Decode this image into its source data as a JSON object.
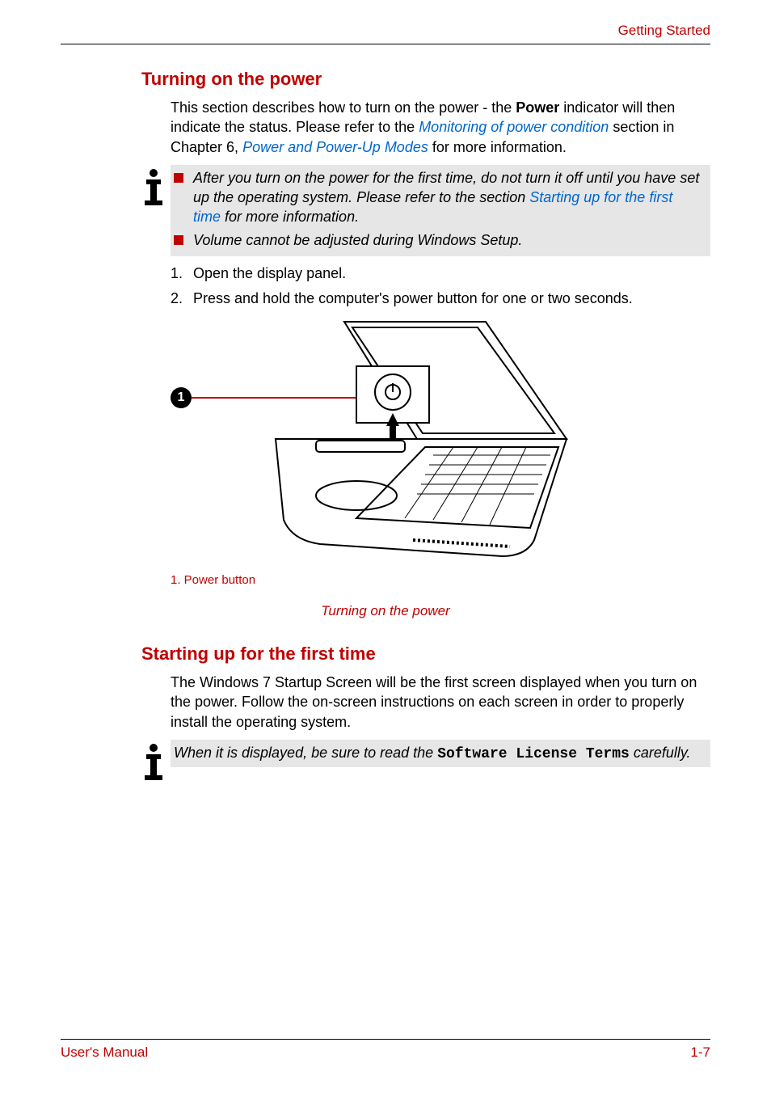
{
  "header": {
    "section": "Getting Started"
  },
  "section1": {
    "heading": "Turning on the power",
    "para_a": "This section describes how to turn on the power - the ",
    "para_b_bold": "Power",
    "para_c": " indicator will then indicate the status. Please refer to the ",
    "link1": "Monitoring of power condition",
    "para_d": " section in Chapter 6, ",
    "link2": "Power and Power-Up Modes",
    "para_e": " for more information.",
    "note_bullets": [
      {
        "pre": "After you turn on the power for the first time, do not turn it off until you have set up the operating system. Please refer to the section ",
        "link": "Starting up for the first time",
        "post": " for more information."
      },
      {
        "pre": "Volume cannot be adjusted during Windows Setup.",
        "link": "",
        "post": ""
      }
    ],
    "steps": [
      "Open the display panel.",
      "Press and hold the computer's power button for one or two seconds."
    ],
    "callout_number": "1",
    "figure_legend": "1. Power button",
    "figure_caption": "Turning on the power"
  },
  "section2": {
    "heading": "Starting up for the first time",
    "para": "The Windows 7 Startup Screen will be the first screen displayed when you turn on the power. Follow the on-screen instructions on each screen in order to properly install the operating system.",
    "note_pre": "When it is displayed, be sure to read the ",
    "note_mono": "Software License Terms",
    "note_post": " carefully."
  },
  "footer": {
    "left": "User's Manual",
    "right": "1-7"
  }
}
